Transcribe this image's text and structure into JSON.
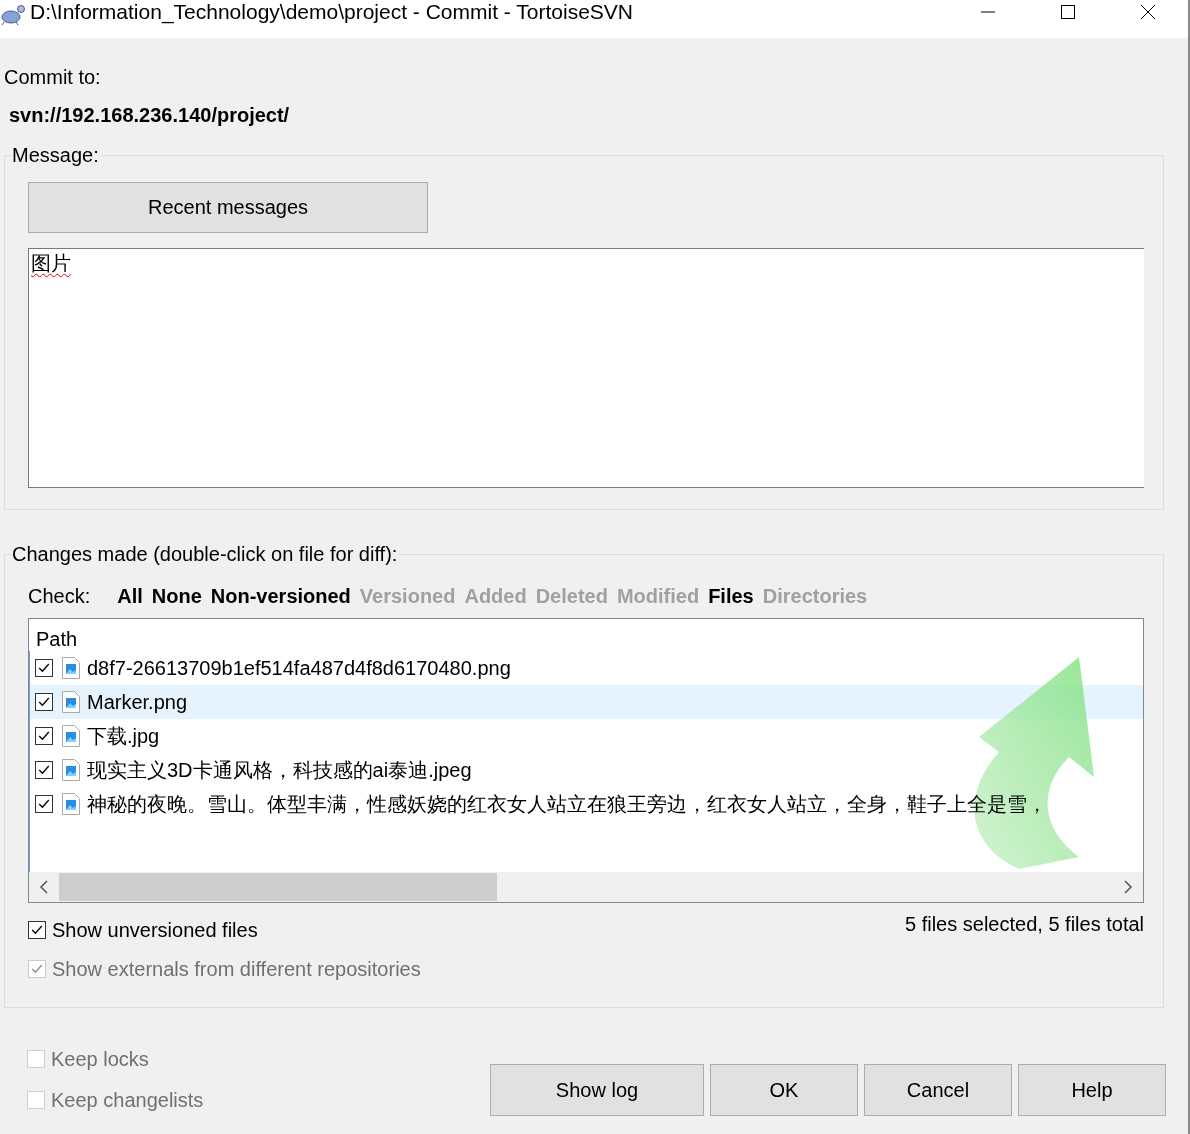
{
  "window": {
    "title": "D:\\Information_Technology\\demo\\project - Commit - TortoiseSVN"
  },
  "commit_to": {
    "label": "Commit to:",
    "url": "svn://192.168.236.140/project/"
  },
  "message": {
    "legend": "Message:",
    "recent_button": "Recent messages",
    "value": "图片"
  },
  "changes": {
    "legend": "Changes made (double-click on file for diff):",
    "check_label": "Check:",
    "filters": [
      {
        "label": "All",
        "disabled": false
      },
      {
        "label": "None",
        "disabled": false
      },
      {
        "label": "Non-versioned",
        "disabled": false
      },
      {
        "label": "Versioned",
        "disabled": true
      },
      {
        "label": "Added",
        "disabled": true
      },
      {
        "label": "Deleted",
        "disabled": true
      },
      {
        "label": "Modified",
        "disabled": true
      },
      {
        "label": "Files",
        "disabled": false
      },
      {
        "label": "Directories",
        "disabled": true
      }
    ],
    "column": "Path",
    "files": [
      {
        "path": "d8f7-26613709b1ef514fa487d4f8d6170480.png",
        "checked": true,
        "selected": false
      },
      {
        "path": "Marker.png",
        "checked": true,
        "selected": true
      },
      {
        "path": "下载.jpg",
        "checked": true,
        "selected": false
      },
      {
        "path": "现实主义3D卡通风格，科技感的ai泰迪.jpeg",
        "checked": true,
        "selected": false
      },
      {
        "path": "神秘的夜晚。雪山。体型丰满，性感妖娆的红衣女人站立在狼王旁边，红衣女人站立，全身，鞋子上全是雪，",
        "checked": true,
        "selected": false
      }
    ],
    "options": [
      {
        "label": "Show unversioned files",
        "checked": true,
        "disabled": false
      },
      {
        "label": "Show externals from different repositories",
        "checked": true,
        "disabled": true
      }
    ],
    "summary": "5 files selected, 5 files total"
  },
  "bottom_options": [
    {
      "label": "Keep locks",
      "checked": false,
      "disabled": true
    },
    {
      "label": "Keep changelists",
      "checked": false,
      "disabled": true
    }
  ],
  "buttons": [
    "Show log",
    "OK",
    "Cancel",
    "Help"
  ]
}
